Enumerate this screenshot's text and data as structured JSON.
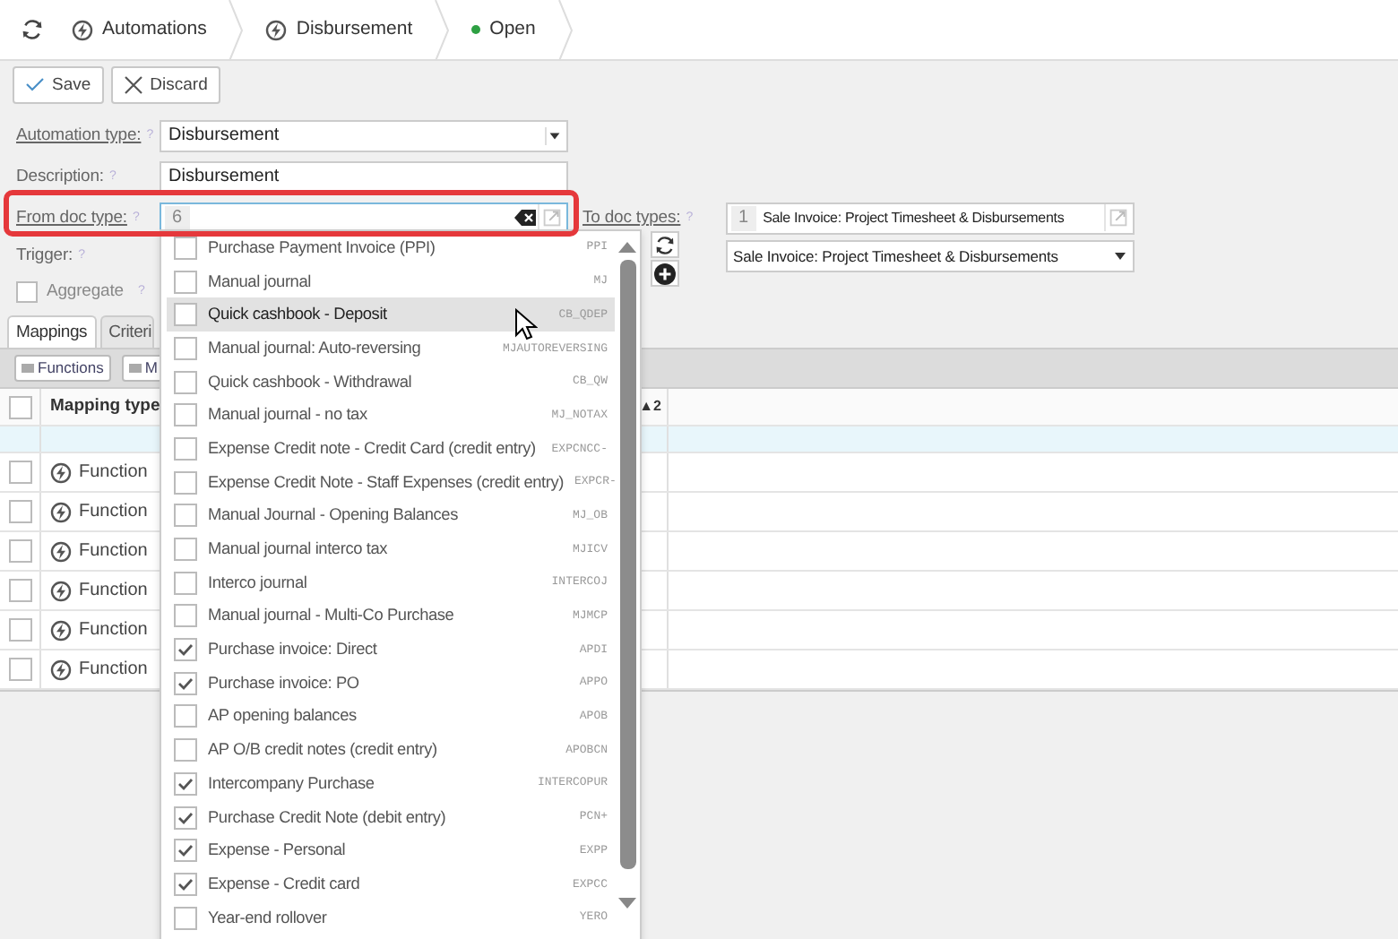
{
  "breadcrumb": [
    {
      "label": "Automations",
      "kind": "link"
    },
    {
      "label": "Disbursement",
      "kind": "link"
    },
    {
      "label": "Open",
      "kind": "status",
      "color": "#2ea043"
    }
  ],
  "toolbar": [
    {
      "label": "Save",
      "kind": "save"
    },
    {
      "label": "Discard",
      "kind": "discard"
    }
  ],
  "form": {
    "automation_type": {
      "label": "Automation type:",
      "help": "?",
      "value": "Disbursement"
    },
    "description": {
      "label": "Description:",
      "help": "?",
      "value": "Disbursement"
    },
    "from_doc_type": {
      "label": "From doc type:",
      "help": "?",
      "count": "6",
      "highlighted": true
    },
    "to_doc_types": {
      "label": "To doc types:",
      "help": "?",
      "count": "1",
      "value": "Sale Invoice: Project Timesheet & Disbursements",
      "select_value": "Sale Invoice: Project Timesheet & Disbursements"
    },
    "trigger": {
      "label": "Trigger:",
      "help": "?"
    },
    "aggregate": {
      "label": "Aggregate",
      "help": "?",
      "checked": false
    }
  },
  "tabs": [
    {
      "label": "Mappings",
      "selected": true
    },
    {
      "label": "Criteri",
      "selected": false
    }
  ],
  "mapping_toolbar": [
    "Functions",
    "M"
  ],
  "table": {
    "select_all_checked": false,
    "columns": [
      {
        "label": "Mapping type",
        "sort_badge": "▲2"
      }
    ],
    "rows": [
      {
        "mapping_type": "Function",
        "checked": false
      },
      {
        "mapping_type": "Function",
        "checked": false
      },
      {
        "mapping_type": "Function",
        "checked": false
      },
      {
        "mapping_type": "Function",
        "checked": false
      },
      {
        "mapping_type": "Function",
        "checked": false
      },
      {
        "mapping_type": "Function",
        "checked": false
      }
    ]
  },
  "dropdown": {
    "items": [
      {
        "label": "Purchase Payment Invoice (PPI)",
        "code": "PPI",
        "checked": false,
        "highlighted": false
      },
      {
        "label": "Manual journal",
        "code": "MJ",
        "checked": false,
        "highlighted": false
      },
      {
        "label": "Quick cashbook - Deposit",
        "code": "CB_QDEP",
        "checked": false,
        "highlighted": true
      },
      {
        "label": "Manual journal: Auto-reversing",
        "code": "MJAUTOREVERSING",
        "checked": false,
        "highlighted": false
      },
      {
        "label": "Quick cashbook - Withdrawal",
        "code": "CB_QW",
        "checked": false,
        "highlighted": false
      },
      {
        "label": "Manual journal - no tax",
        "code": "MJ_NOTAX",
        "checked": false,
        "highlighted": false
      },
      {
        "label": "Expense Credit note - Credit Card (credit entry)",
        "code": "EXPCNCC-",
        "checked": false,
        "highlighted": false
      },
      {
        "label": "Expense Credit Note - Staff Expenses (credit entry)",
        "code": "EXPCR-",
        "checked": false,
        "highlighted": false
      },
      {
        "label": "Manual Journal - Opening Balances",
        "code": "MJ_OB",
        "checked": false,
        "highlighted": false
      },
      {
        "label": "Manual journal interco tax",
        "code": "MJICV",
        "checked": false,
        "highlighted": false
      },
      {
        "label": "Interco journal",
        "code": "INTERCOJ",
        "checked": false,
        "highlighted": false
      },
      {
        "label": "Manual journal - Multi-Co Purchase",
        "code": "MJMCP",
        "checked": false,
        "highlighted": false
      },
      {
        "label": "Purchase invoice: Direct",
        "code": "APDI",
        "checked": true,
        "highlighted": false
      },
      {
        "label": "Purchase invoice: PO",
        "code": "APPO",
        "checked": true,
        "highlighted": false
      },
      {
        "label": "AP opening balances",
        "code": "APOB",
        "checked": false,
        "highlighted": false
      },
      {
        "label": "AP O/B credit notes (credit entry)",
        "code": "APOBCN",
        "checked": false,
        "highlighted": false
      },
      {
        "label": "Intercompany Purchase",
        "code": "INTERCOPUR",
        "checked": true,
        "highlighted": false
      },
      {
        "label": "Purchase Credit Note (debit entry)",
        "code": "PCN+",
        "checked": true,
        "highlighted": false
      },
      {
        "label": "Expense - Personal",
        "code": "EXPP",
        "checked": true,
        "highlighted": false
      },
      {
        "label": "Expense - Credit card",
        "code": "EXPCC",
        "checked": true,
        "highlighted": false
      },
      {
        "label": "Year-end rollover",
        "code": "YERO",
        "checked": false,
        "highlighted": false
      }
    ]
  }
}
